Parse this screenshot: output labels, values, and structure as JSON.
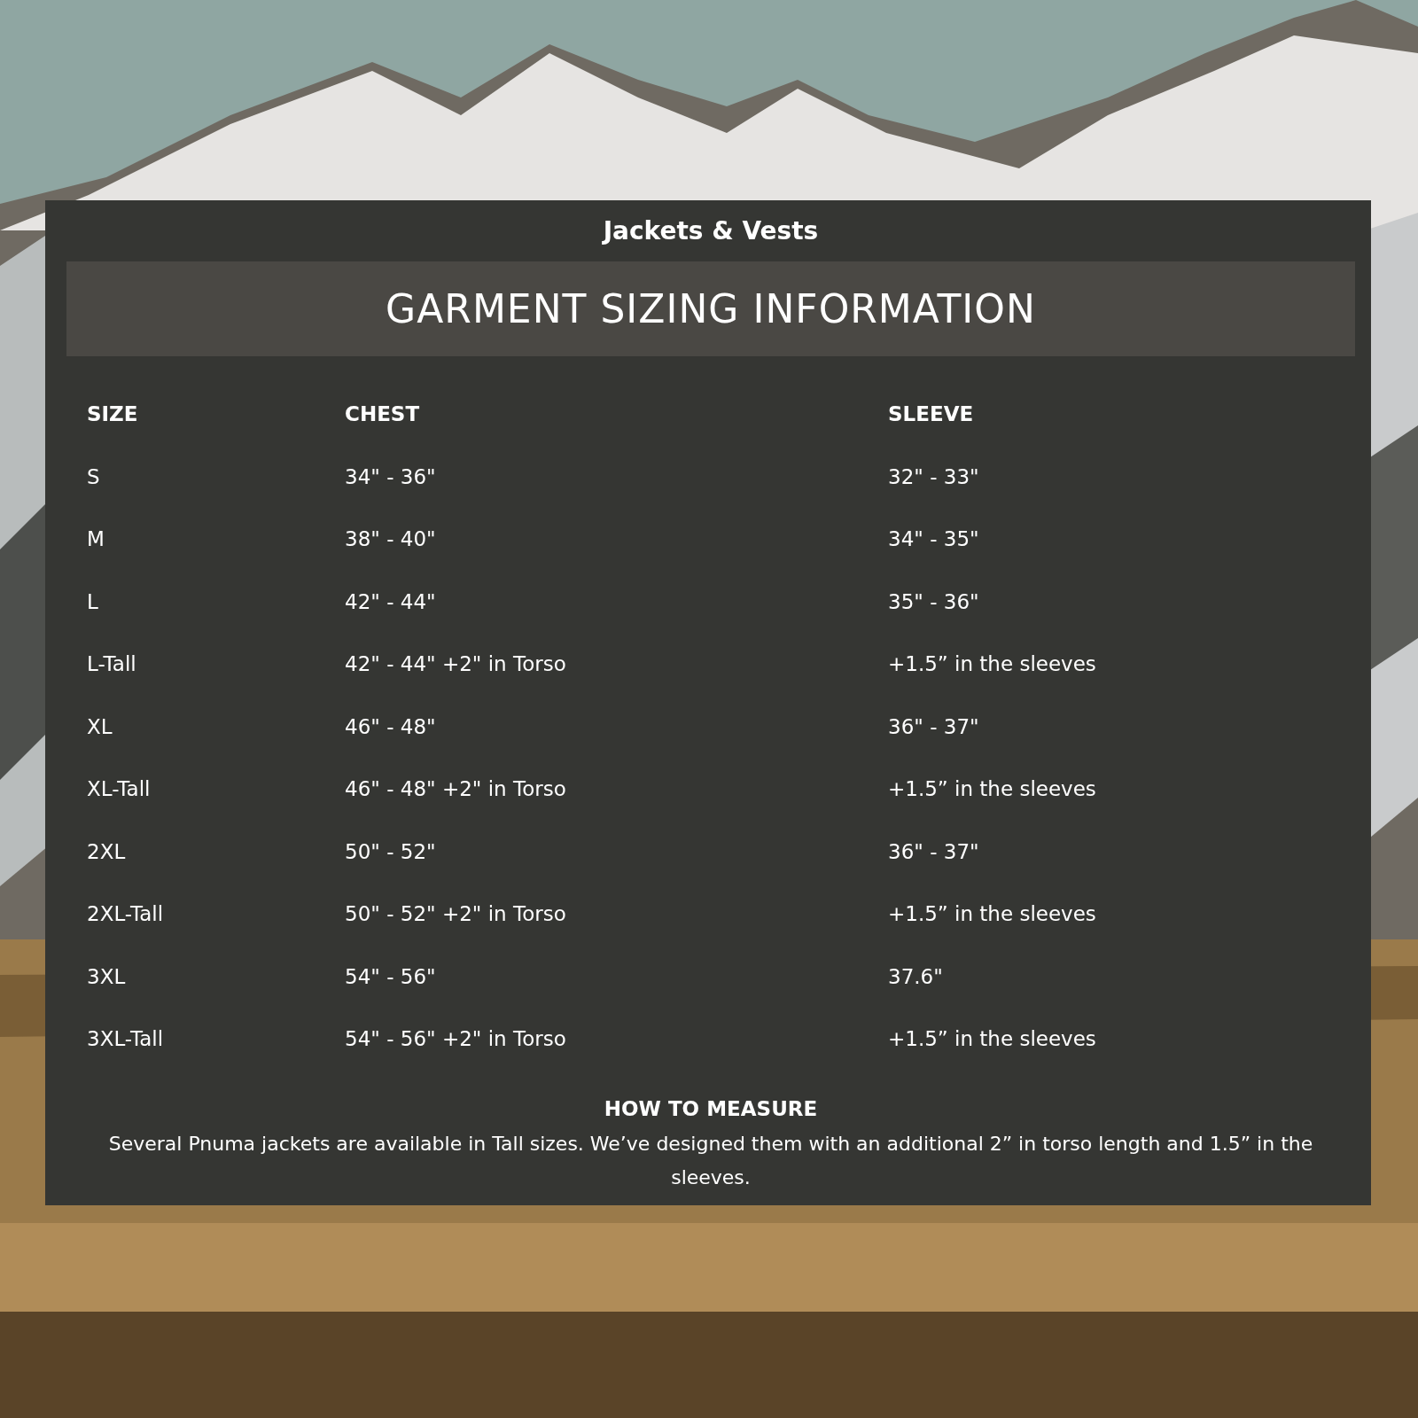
{
  "panel": {
    "category": "Jackets & Vests",
    "title": "GARMENT SIZING INFORMATION",
    "table": {
      "columns": [
        "SIZE",
        "CHEST",
        "SLEEVE"
      ],
      "rows": [
        [
          "S",
          "34\" - 36\"",
          "32\" - 33\""
        ],
        [
          "M",
          "38\" - 40\"",
          "34\" - 35\""
        ],
        [
          "L",
          "42\" - 44\"",
          "35\" - 36\""
        ],
        [
          "L-Tall",
          "42\" - 44\" +2\" in Torso",
          "+1.5” in the sleeves"
        ],
        [
          "XL",
          "46\" - 48\"",
          "36\" - 37\""
        ],
        [
          "XL-Tall",
          "46\" - 48\" +2\" in Torso",
          "+1.5” in the sleeves"
        ],
        [
          "2XL",
          "50\" - 52\"",
          "36\" - 37\""
        ],
        [
          "2XL-Tall",
          "50\" - 52\" +2\" in Torso",
          "+1.5” in the sleeves"
        ],
        [
          "3XL",
          "54\" - 56\"",
          "37.6\""
        ],
        [
          "3XL-Tall",
          "54\" - 56\" +2\" in Torso",
          "+1.5” in the sleeves"
        ]
      ]
    },
    "measure": {
      "heading": "HOW TO MEASURE",
      "text": "Several Pnuma jackets are available in Tall sizes. We’ve designed them with an additional 2” in torso length and 1.5” in the sleeves."
    }
  }
}
